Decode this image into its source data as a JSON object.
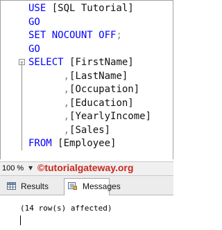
{
  "editor": {
    "lines": [
      {
        "parts": [
          {
            "text": "USE ",
            "cls": "kw"
          },
          {
            "text": "[SQL Tutorial]",
            "cls": "pl"
          }
        ]
      },
      {
        "parts": [
          {
            "text": "GO",
            "cls": "kw"
          }
        ]
      },
      {
        "parts": [
          {
            "text": "SET NOCOUNT OFF",
            "cls": "kw"
          },
          {
            "text": ";",
            "cls": "gr"
          }
        ]
      },
      {
        "parts": [
          {
            "text": "GO",
            "cls": "kw"
          }
        ]
      },
      {
        "parts": [
          {
            "text": "SELECT ",
            "cls": "kw"
          },
          {
            "text": "[FirstName]",
            "cls": "pl"
          }
        ]
      },
      {
        "parts": [
          {
            "text": "      ,",
            "cls": "gr"
          },
          {
            "text": "[LastName]",
            "cls": "pl"
          }
        ]
      },
      {
        "parts": [
          {
            "text": "      ,",
            "cls": "gr"
          },
          {
            "text": "[Occupation]",
            "cls": "pl"
          }
        ]
      },
      {
        "parts": [
          {
            "text": "      ,",
            "cls": "gr"
          },
          {
            "text": "[Education]",
            "cls": "pl"
          }
        ]
      },
      {
        "parts": [
          {
            "text": "      ,",
            "cls": "gr"
          },
          {
            "text": "[YearlyIncome]",
            "cls": "pl"
          }
        ]
      },
      {
        "parts": [
          {
            "text": "      ,",
            "cls": "gr"
          },
          {
            "text": "[Sales]",
            "cls": "pl"
          }
        ]
      },
      {
        "parts": [
          {
            "text": "FROM ",
            "cls": "kw"
          },
          {
            "text": "[Employee]",
            "cls": "pl"
          }
        ]
      }
    ]
  },
  "zoom": {
    "value": "100 %"
  },
  "watermark": "©tutorialgateway.org",
  "tabs": {
    "results": {
      "label": "Results",
      "icon": "results-grid-icon"
    },
    "messages": {
      "label": "Messages",
      "icon": "messages-icon"
    }
  },
  "messages": {
    "text": "(14 row(s) affected)"
  },
  "colors": {
    "keyword": "#0000ff",
    "identifier": "#111111",
    "punctuation": "#808080",
    "watermark": "#c8281e"
  }
}
